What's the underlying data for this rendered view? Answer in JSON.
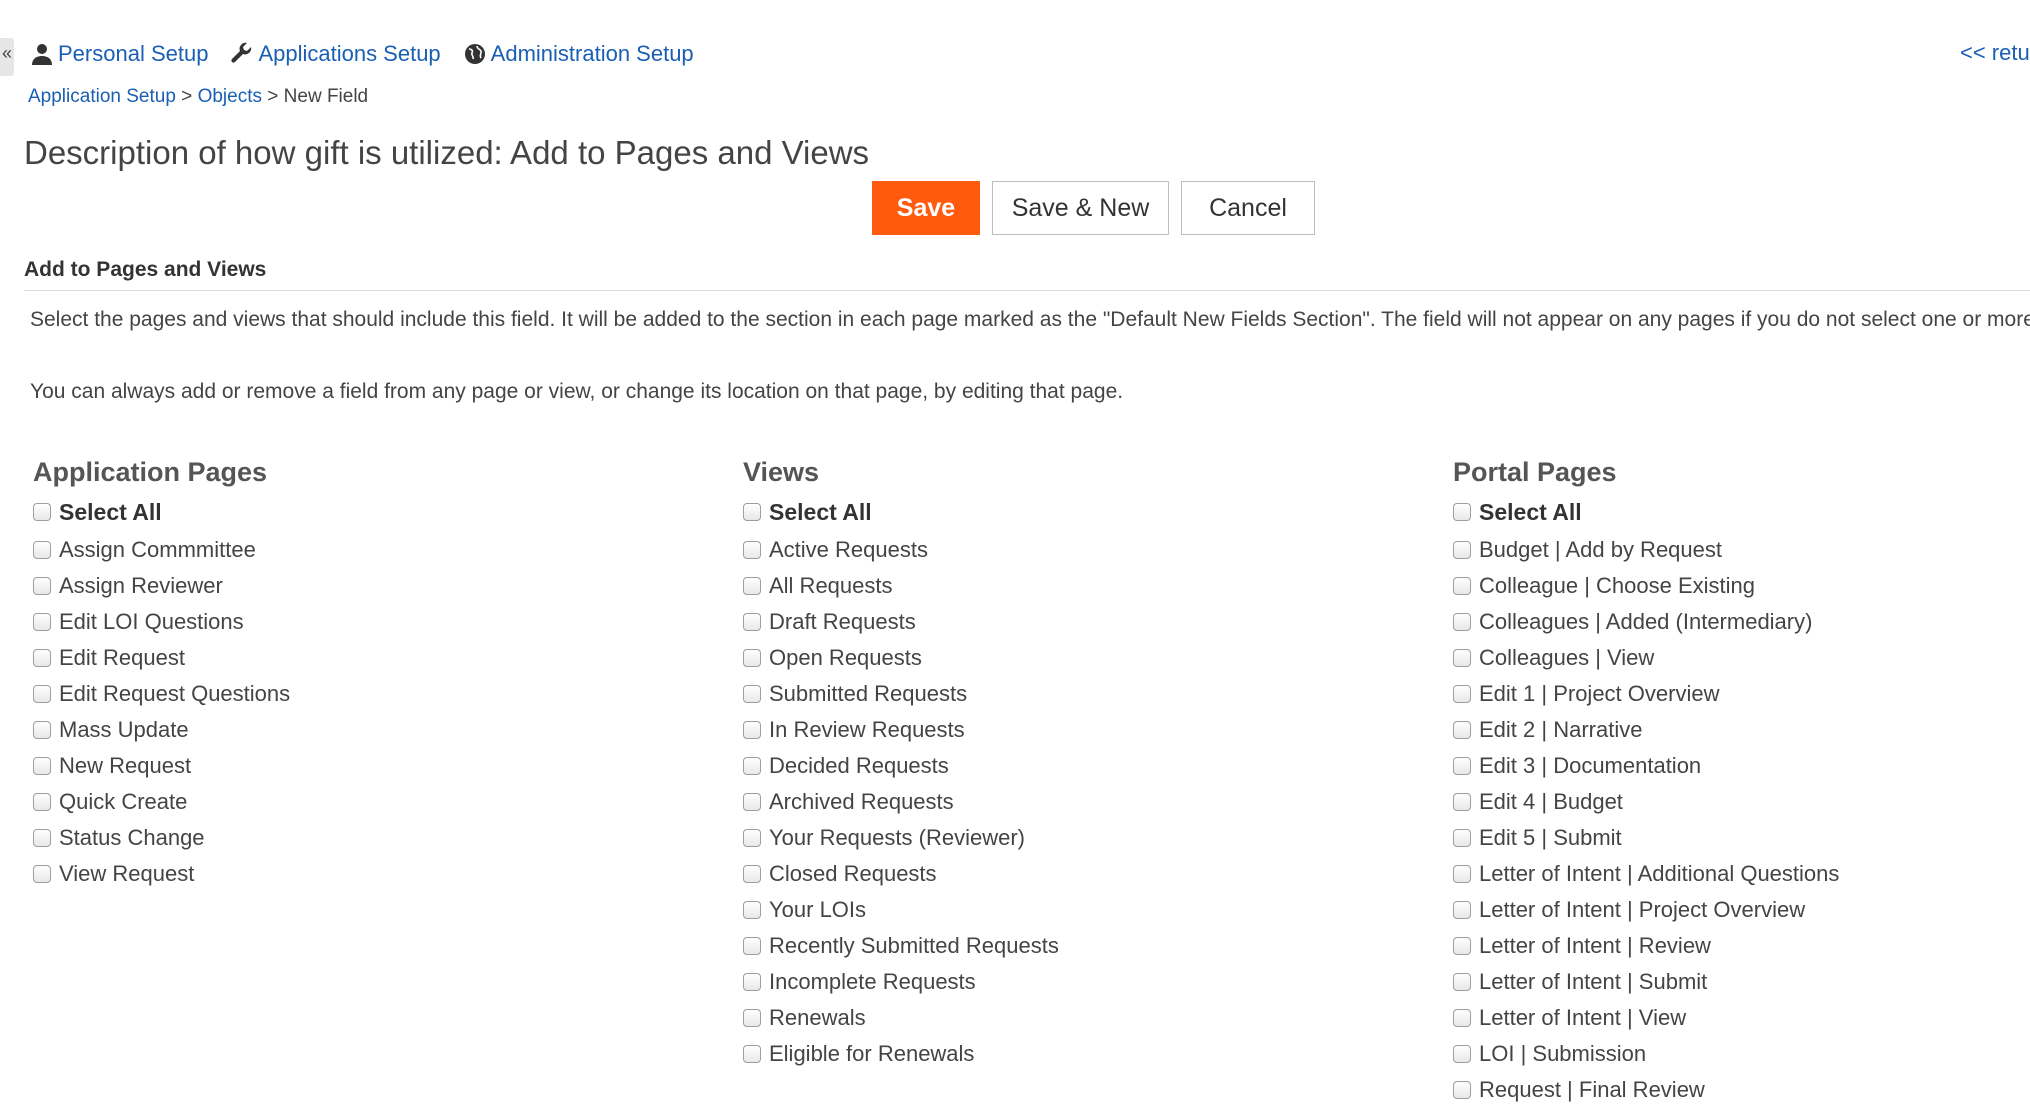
{
  "nav": {
    "collapse_glyph": "«",
    "items": [
      {
        "label": "Personal Setup",
        "icon": "user-icon"
      },
      {
        "label": "Applications Setup",
        "icon": "wrench-icon"
      },
      {
        "label": "Administration Setup",
        "icon": "globe-icon"
      }
    ],
    "return_label": "<< retu"
  },
  "breadcrumb": {
    "crumbs": [
      "Application Setup",
      "Objects"
    ],
    "separator": ">",
    "current": "New Field"
  },
  "page": {
    "title": "Description of how gift is utilized: Add to Pages and Views"
  },
  "toolbar": {
    "save_label": "Save",
    "save_new_label": "Save & New",
    "cancel_label": "Cancel",
    "save_color": "#ff5a0e"
  },
  "section": {
    "header": "Add to Pages and Views",
    "description_1": "Select the pages and views that should include this field. It will be added to the section in each page marked as the \"Default New Fields Section\". The field will not appear on any pages if you do not select one or more",
    "description_2": "You can always add or remove a field from any page or view, or change its location on that page, by editing that page."
  },
  "columns": [
    {
      "heading": "Application Pages",
      "select_all": "Select All",
      "items": [
        "Assign Commmittee",
        "Assign Reviewer",
        "Edit LOI Questions",
        "Edit Request",
        "Edit Request Questions",
        "Mass Update",
        "New Request",
        "Quick Create",
        "Status Change",
        "View Request"
      ]
    },
    {
      "heading": "Views",
      "select_all": "Select All",
      "items": [
        "Active Requests",
        "All Requests",
        "Draft Requests",
        "Open Requests",
        "Submitted Requests",
        "In Review Requests",
        "Decided Requests",
        "Archived Requests",
        "Your Requests (Reviewer)",
        "Closed Requests",
        "Your LOIs",
        "Recently Submitted Requests",
        "Incomplete Requests",
        "Renewals",
        "Eligible for Renewals"
      ]
    },
    {
      "heading": "Portal Pages",
      "select_all": "Select All",
      "items": [
        "Budget | Add by Request",
        "Colleague | Choose Existing",
        "Colleagues | Added (Intermediary)",
        "Colleagues | View",
        "Edit 1 | Project Overview",
        "Edit 2 | Narrative",
        "Edit 3 | Documentation",
        "Edit 4 | Budget",
        "Edit 5 | Submit",
        "Letter of Intent | Additional Questions",
        "Letter of Intent | Project Overview",
        "Letter of Intent | Review",
        "Letter of Intent | Submit",
        "Letter of Intent | View",
        "LOI | Submission",
        "Request | Final Review"
      ]
    }
  ]
}
